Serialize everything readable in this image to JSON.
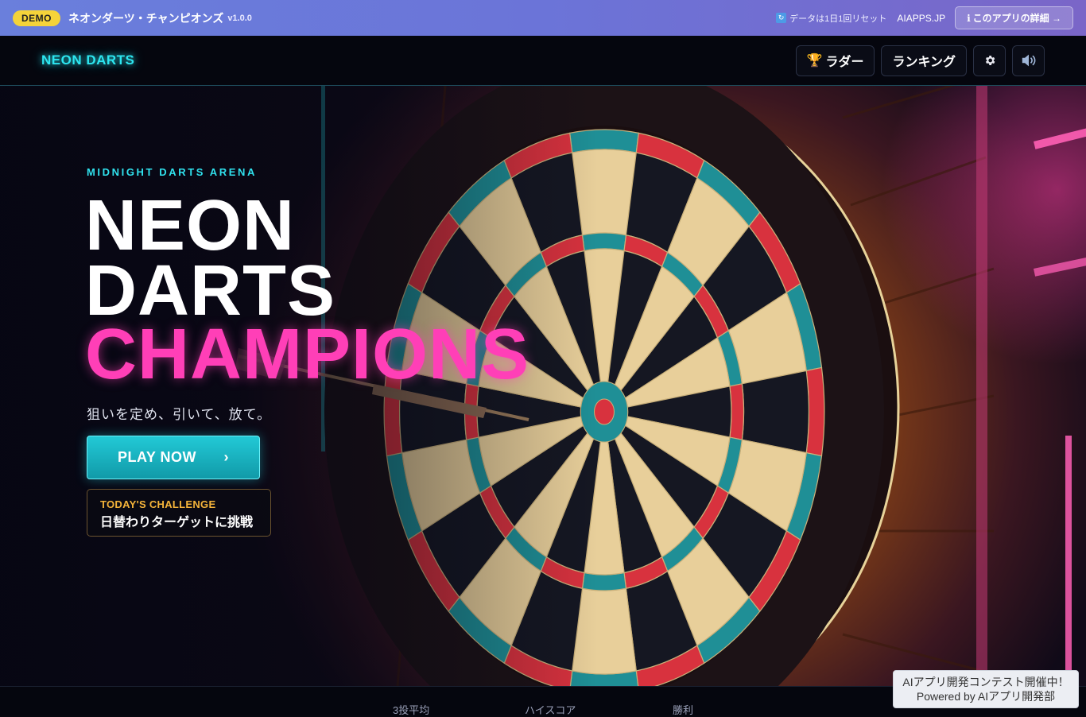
{
  "demo_bar": {
    "badge": "DEMO",
    "app_title": "ネオンダーツ・チャンピオンズ",
    "version": "v1.0.0",
    "reset_note": "データは1日1回リセット",
    "site_link": "AIAPPS.JP",
    "detail_button": "このアプリの詳細 →"
  },
  "nav": {
    "logo": "NEON DARTS",
    "ladder_label": "ラダー",
    "ranking_label": "ランキング",
    "settings_icon": "gear-icon",
    "sound_icon": "speaker-icon"
  },
  "hero": {
    "kicker": "MIDNIGHT DARTS ARENA",
    "title_line1": "NEON",
    "title_line2": "DARTS",
    "title_line3": "CHAMPIONS",
    "tagline": "狙いを定め、引いて、放て。",
    "play_button": "PLAY NOW",
    "play_chevron": "›",
    "challenge_kicker": "TODAY'S CHALLENGE",
    "challenge_title": "日替わりターゲットに挑戦"
  },
  "stats": {
    "labels": [
      "3投平均",
      "ハイスコア",
      "勝利"
    ]
  },
  "contest": {
    "line1": "AIアプリ開発コンテスト開催中！",
    "line2": "Powered by AIアプリ開発部"
  },
  "colors": {
    "accent_cyan": "#2de6f0",
    "accent_pink": "#ff3fb7",
    "accent_gold": "#f5b43a",
    "demo_badge": "#f5d33a"
  }
}
